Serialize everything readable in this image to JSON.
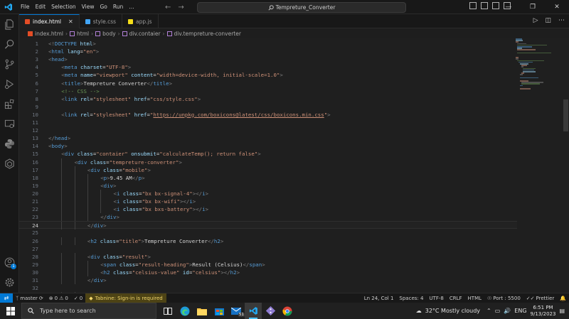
{
  "menu": [
    "File",
    "Edit",
    "Selection",
    "View",
    "Go",
    "Run",
    "…"
  ],
  "search": {
    "label": "Tempreture_Converter"
  },
  "tabs": [
    {
      "label": "index.html",
      "color": "#e44d26",
      "active": true
    },
    {
      "label": "style.css",
      "color": "#42a5f5",
      "active": false
    },
    {
      "label": "app.js",
      "color": "#f5de19",
      "active": false
    }
  ],
  "breadcrumb": [
    "index.html",
    "html",
    "body",
    "div.contaier",
    "div.tempreture-converter"
  ],
  "current_line": 24,
  "code_lines": [
    {
      "n": "1",
      "indent": 0,
      "tokens": [
        [
          "p",
          "<!"
        ],
        [
          "t",
          "DOCTYPE"
        ],
        [
          "w",
          " "
        ],
        [
          "a",
          "html"
        ],
        [
          "p",
          ">"
        ]
      ]
    },
    {
      "n": "2",
      "indent": 0,
      "tokens": [
        [
          "p",
          "<"
        ],
        [
          "t",
          "html"
        ],
        [
          "w",
          " "
        ],
        [
          "a",
          "lang"
        ],
        [
          "w",
          "="
        ],
        [
          "s",
          "\"en\""
        ],
        [
          "p",
          ">"
        ]
      ]
    },
    {
      "n": "3",
      "indent": 0,
      "tokens": [
        [
          "p",
          "<"
        ],
        [
          "t",
          "head"
        ],
        [
          "p",
          ">"
        ]
      ]
    },
    {
      "n": "4",
      "indent": 1,
      "tokens": [
        [
          "p",
          "<"
        ],
        [
          "t",
          "meta"
        ],
        [
          "w",
          " "
        ],
        [
          "a",
          "charset"
        ],
        [
          "w",
          "="
        ],
        [
          "s",
          "\"UTF-8\""
        ],
        [
          "p",
          ">"
        ]
      ]
    },
    {
      "n": "5",
      "indent": 1,
      "tokens": [
        [
          "p",
          "<"
        ],
        [
          "t",
          "meta"
        ],
        [
          "w",
          " "
        ],
        [
          "a",
          "name"
        ],
        [
          "w",
          "="
        ],
        [
          "s",
          "\"viewport\""
        ],
        [
          "w",
          " "
        ],
        [
          "a",
          "content"
        ],
        [
          "w",
          "="
        ],
        [
          "s",
          "\"width=device-width, initial-scale=1.0\""
        ],
        [
          "p",
          ">"
        ]
      ]
    },
    {
      "n": "6",
      "indent": 1,
      "tokens": [
        [
          "p",
          "<"
        ],
        [
          "t",
          "title"
        ],
        [
          "p",
          ">"
        ],
        [
          "w",
          "Tempreture Converter"
        ],
        [
          "p",
          "</"
        ],
        [
          "t",
          "title"
        ],
        [
          "p",
          ">"
        ]
      ]
    },
    {
      "n": "7",
      "indent": 1,
      "tokens": [
        [
          "c",
          "<!-- CSS -->"
        ]
      ]
    },
    {
      "n": "8",
      "indent": 1,
      "tokens": [
        [
          "p",
          "<"
        ],
        [
          "t",
          "link"
        ],
        [
          "w",
          " "
        ],
        [
          "a",
          "rel"
        ],
        [
          "w",
          "="
        ],
        [
          "s",
          "\"stylesheet\""
        ],
        [
          "w",
          " "
        ],
        [
          "a",
          "href"
        ],
        [
          "w",
          "="
        ],
        [
          "s",
          "\"css/style.css\""
        ],
        [
          "p",
          ">"
        ]
      ]
    },
    {
      "n": "9",
      "indent": 0,
      "tokens": []
    },
    {
      "n": "10",
      "indent": 1,
      "tokens": [
        [
          "p",
          "<"
        ],
        [
          "t",
          "link"
        ],
        [
          "w",
          " "
        ],
        [
          "a",
          "rel"
        ],
        [
          "w",
          "="
        ],
        [
          "s",
          "\"stylesheet\""
        ],
        [
          "w",
          " "
        ],
        [
          "a",
          "href"
        ],
        [
          "w",
          "="
        ],
        [
          "s",
          "\""
        ],
        [
          "u",
          "https://unpkg.com/boxicons@latest/css/boxicons.min.css"
        ],
        [
          "s",
          "\""
        ],
        [
          "p",
          ">"
        ]
      ]
    },
    {
      "n": "11",
      "indent": 0,
      "tokens": []
    },
    {
      "n": "12",
      "indent": 0,
      "tokens": []
    },
    {
      "n": "13",
      "indent": 0,
      "tokens": [
        [
          "p",
          "</"
        ],
        [
          "t",
          "head"
        ],
        [
          "p",
          ">"
        ]
      ]
    },
    {
      "n": "14",
      "indent": 0,
      "tokens": [
        [
          "p",
          "<"
        ],
        [
          "t",
          "body"
        ],
        [
          "p",
          ">"
        ]
      ]
    },
    {
      "n": "15",
      "indent": 1,
      "tokens": [
        [
          "p",
          "<"
        ],
        [
          "t",
          "div"
        ],
        [
          "w",
          " "
        ],
        [
          "a",
          "class"
        ],
        [
          "w",
          "="
        ],
        [
          "s",
          "\"contaier\""
        ],
        [
          "w",
          " "
        ],
        [
          "a",
          "onsubmit"
        ],
        [
          "w",
          "="
        ],
        [
          "s",
          "\"calculateTemp(); return false\""
        ],
        [
          "p",
          ">"
        ]
      ]
    },
    {
      "n": "16",
      "indent": 2,
      "tokens": [
        [
          "p",
          "<"
        ],
        [
          "t",
          "div"
        ],
        [
          "w",
          " "
        ],
        [
          "a",
          "class"
        ],
        [
          "w",
          "="
        ],
        [
          "s",
          "\"tempreture-converter\""
        ],
        [
          "p",
          ">"
        ]
      ]
    },
    {
      "n": "17",
      "indent": 3,
      "tokens": [
        [
          "p",
          "<"
        ],
        [
          "t",
          "div"
        ],
        [
          "w",
          " "
        ],
        [
          "a",
          "class"
        ],
        [
          "w",
          "="
        ],
        [
          "s",
          "\"mobile\""
        ],
        [
          "p",
          ">"
        ]
      ]
    },
    {
      "n": "18",
      "indent": 4,
      "tokens": [
        [
          "p",
          "<"
        ],
        [
          "t",
          "p"
        ],
        [
          "p",
          ">"
        ],
        [
          "w",
          "9.45 AM"
        ],
        [
          "p",
          "</"
        ],
        [
          "t",
          "p"
        ],
        [
          "p",
          ">"
        ]
      ]
    },
    {
      "n": "19",
      "indent": 4,
      "tokens": [
        [
          "p",
          "<"
        ],
        [
          "t",
          "div"
        ],
        [
          "p",
          ">"
        ]
      ]
    },
    {
      "n": "20",
      "indent": 5,
      "tokens": [
        [
          "p",
          "<"
        ],
        [
          "t",
          "i"
        ],
        [
          "w",
          " "
        ],
        [
          "a",
          "class"
        ],
        [
          "w",
          "="
        ],
        [
          "s",
          "\"bx bx-signal-4\""
        ],
        [
          "p",
          "></"
        ],
        [
          "t",
          "i"
        ],
        [
          "p",
          ">"
        ]
      ]
    },
    {
      "n": "21",
      "indent": 5,
      "tokens": [
        [
          "p",
          "<"
        ],
        [
          "t",
          "i"
        ],
        [
          "w",
          " "
        ],
        [
          "a",
          "class"
        ],
        [
          "w",
          "="
        ],
        [
          "s",
          "\"bx bx-wifi\""
        ],
        [
          "p",
          "></"
        ],
        [
          "t",
          "i"
        ],
        [
          "p",
          ">"
        ]
      ]
    },
    {
      "n": "22",
      "indent": 5,
      "tokens": [
        [
          "p",
          "<"
        ],
        [
          "t",
          "i"
        ],
        [
          "w",
          " "
        ],
        [
          "a",
          "class"
        ],
        [
          "w",
          "="
        ],
        [
          "s",
          "\"bx bxs-battery\""
        ],
        [
          "p",
          "></"
        ],
        [
          "t",
          "i"
        ],
        [
          "p",
          ">"
        ]
      ]
    },
    {
      "n": "23",
      "indent": 4,
      "tokens": [
        [
          "p",
          "</"
        ],
        [
          "t",
          "div"
        ],
        [
          "p",
          ">"
        ]
      ]
    },
    {
      "n": "24",
      "indent": 3,
      "tokens": [
        [
          "p",
          "</"
        ],
        [
          "t",
          "div"
        ],
        [
          "p",
          ">"
        ]
      ]
    },
    {
      "n": "25",
      "indent": 0,
      "tokens": []
    },
    {
      "n": "26",
      "indent": 3,
      "tokens": [
        [
          "p",
          "<"
        ],
        [
          "t",
          "h2"
        ],
        [
          "w",
          " "
        ],
        [
          "a",
          "class"
        ],
        [
          "w",
          "="
        ],
        [
          "s",
          "\"title\""
        ],
        [
          "p",
          ">"
        ],
        [
          "w",
          "Tempreture Converter"
        ],
        [
          "p",
          "</"
        ],
        [
          "t",
          "h2"
        ],
        [
          "p",
          ">"
        ]
      ]
    },
    {
      "n": "27",
      "indent": 0,
      "tokens": []
    },
    {
      "n": "28",
      "indent": 3,
      "tokens": [
        [
          "p",
          "<"
        ],
        [
          "t",
          "div"
        ],
        [
          "w",
          " "
        ],
        [
          "a",
          "class"
        ],
        [
          "w",
          "="
        ],
        [
          "s",
          "\"result\""
        ],
        [
          "p",
          ">"
        ]
      ]
    },
    {
      "n": "29",
      "indent": 4,
      "tokens": [
        [
          "p",
          "<"
        ],
        [
          "t",
          "span"
        ],
        [
          "w",
          " "
        ],
        [
          "a",
          "class"
        ],
        [
          "w",
          "="
        ],
        [
          "s",
          "\"result-heading\""
        ],
        [
          "p",
          ">"
        ],
        [
          "w",
          "Result (Celsius)"
        ],
        [
          "p",
          "</"
        ],
        [
          "t",
          "span"
        ],
        [
          "p",
          ">"
        ]
      ]
    },
    {
      "n": "30",
      "indent": 4,
      "tokens": [
        [
          "p",
          "<"
        ],
        [
          "t",
          "h2"
        ],
        [
          "w",
          " "
        ],
        [
          "a",
          "class"
        ],
        [
          "w",
          "="
        ],
        [
          "s",
          "\"celsius-value\""
        ],
        [
          "w",
          " "
        ],
        [
          "a",
          "id"
        ],
        [
          "w",
          "="
        ],
        [
          "s",
          "\"celsius\""
        ],
        [
          "p",
          "></"
        ],
        [
          "t",
          "h2"
        ],
        [
          "p",
          ">"
        ]
      ]
    },
    {
      "n": "31",
      "indent": 3,
      "tokens": [
        [
          "p",
          "</"
        ],
        [
          "t",
          "div"
        ],
        [
          "p",
          ">"
        ]
      ]
    },
    {
      "n": "32",
      "indent": 0,
      "tokens": []
    },
    {
      "n": "33",
      "indent": 3,
      "tokens": [
        [
          "p",
          "<"
        ],
        [
          "t",
          "div"
        ],
        [
          "w",
          " "
        ],
        [
          "a",
          "class"
        ],
        [
          "w",
          "="
        ],
        [
          "s",
          "\"degree-type\""
        ],
        [
          "p",
          ">"
        ]
      ]
    }
  ],
  "status": {
    "branch": "master",
    "errors": "0",
    "warnings": "0",
    "ports_count": "0",
    "tabnine": "Tabnine: Sign-in is required",
    "position": "Ln 24, Col 1",
    "spaces": "Spaces: 4",
    "encoding": "UTF-8",
    "eol": "CRLF",
    "language": "HTML",
    "port": "Port : 5500",
    "prettier": "Prettier"
  },
  "taskbar": {
    "search_placeholder": "Type here to search",
    "weather": "32°C  Mostly cloudy",
    "lang": "ENG",
    "time": "6:51 PM",
    "date": "9/13/2023",
    "mail_badge": "51"
  },
  "colors": {
    "accent": "#0078d4",
    "tabnine_bg": "#4d4315"
  }
}
